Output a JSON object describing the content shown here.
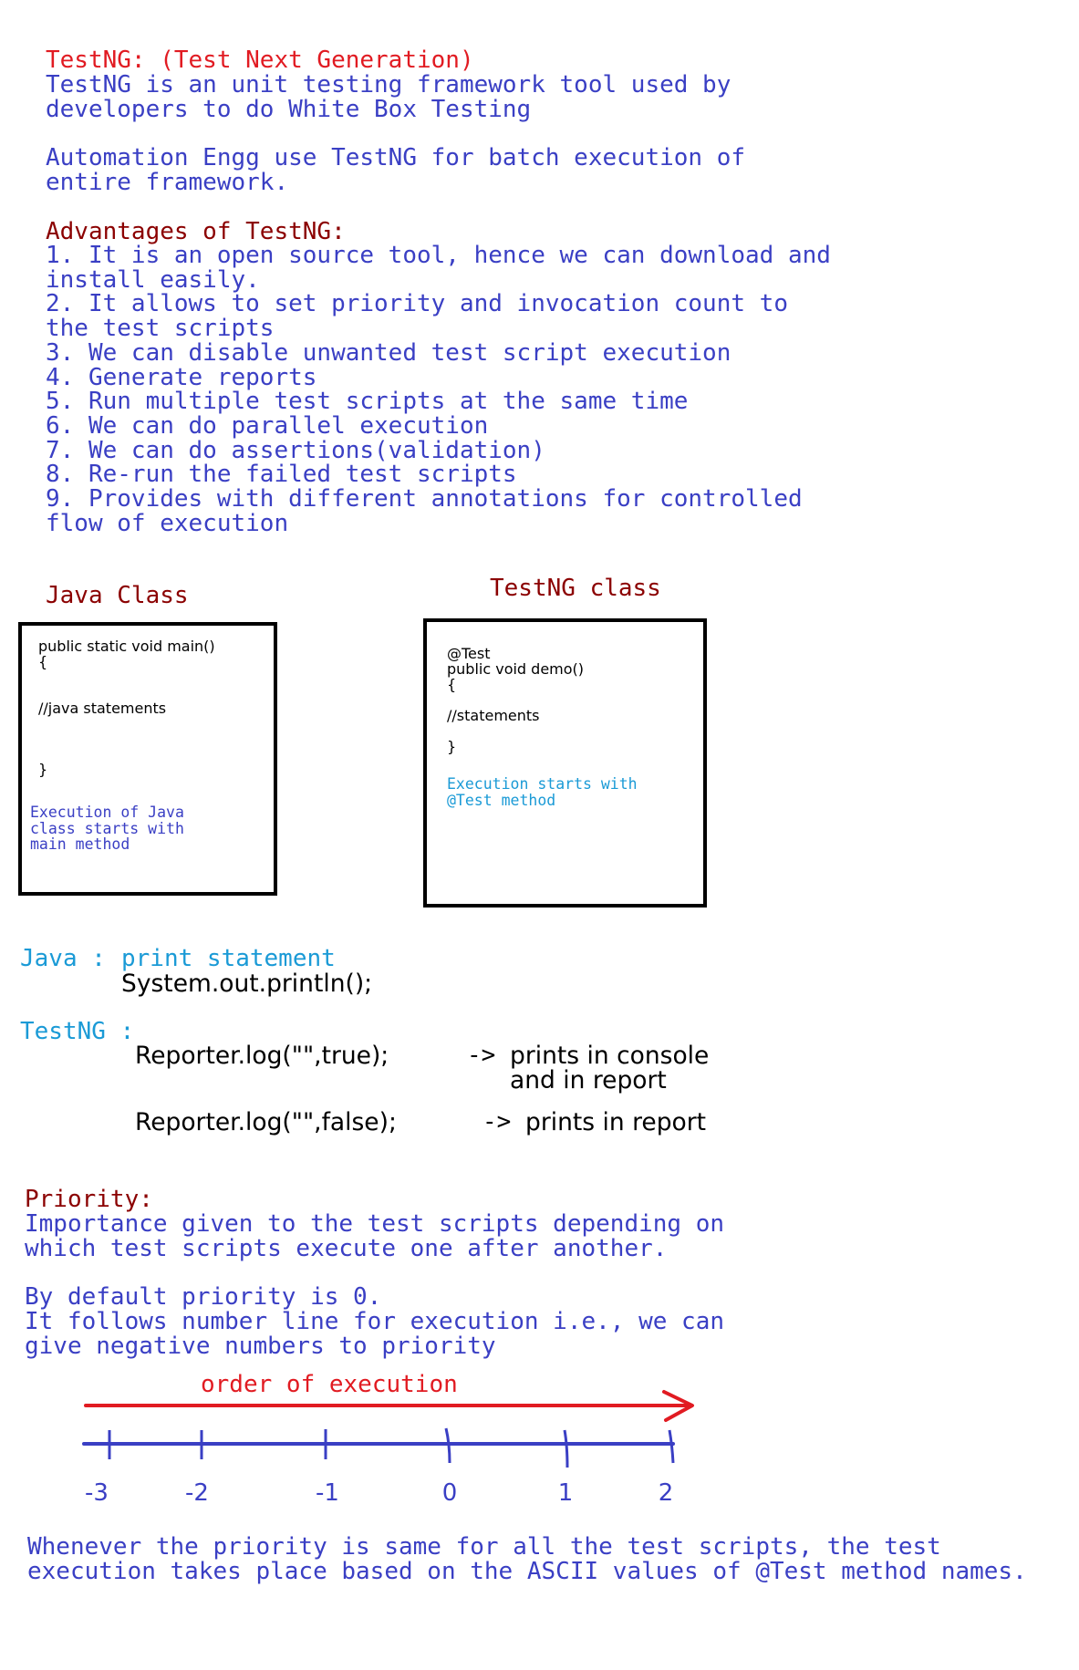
{
  "intro": {
    "title": "TestNG: (Test Next Generation)",
    "description": "TestNG is an unit testing framework tool used by\ndevelopers to do White Box Testing",
    "automation": "Automation Engg use TestNG for batch execution of\nentire framework."
  },
  "advantages": {
    "heading": "Advantages of TestNG:",
    "items": [
      "1. It is an open source tool, hence we can download and\ninstall easily.",
      "2. It allows to set priority and invocation count to\nthe test scripts",
      "3. We can disable unwanted test script execution",
      "4. Generate reports",
      "5. Run multiple test scripts at the same time",
      "6. We can do parallel execution",
      "7. We can do assertions(validation)",
      "8. Re-run the failed test scripts",
      "9. Provides with different annotations for controlled\nflow of execution"
    ]
  },
  "java_class": {
    "label": "Java Class",
    "code_signature": "public static void main()\n{",
    "code_body": "//java statements",
    "code_close": "}",
    "note": "Execution of Java\nclass starts with\nmain method"
  },
  "testng_class": {
    "label": "TestNG class",
    "code_signature": "@Test\npublic void demo()\n{",
    "code_body": "//statements",
    "code_close": "}",
    "note": "Execution starts with\n@Test method"
  },
  "print": {
    "java_label": "Java :",
    "java_desc": "print statement",
    "java_code": "System.out.println();",
    "testng_label": "TestNG :",
    "log_true": "Reporter.log(\"\",true);",
    "log_true_arrow": "->",
    "log_true_desc": "prints in console\nand in report",
    "log_false": "Reporter.log(\"\",false);",
    "log_false_arrow": "->",
    "log_false_desc": "prints in report"
  },
  "priority": {
    "heading": "Priority:",
    "definition": "Importance given to the test scripts depending on\nwhich test scripts execute one after another.",
    "default": "By default priority is 0.\nIt follows number line for execution i.e., we can\ngive negative numbers to priority",
    "order_label": "order of execution",
    "ticks": [
      "-3",
      "-2",
      "-1",
      "0",
      "1",
      "2"
    ],
    "footer": "Whenever the priority is same for all the test scripts, the test\nexecution takes place based on the ASCII values of @Test method names."
  },
  "colors": {
    "red": "#e11b22",
    "maroon": "#8b0000",
    "blue": "#3a3fc4",
    "cyan": "#1a9ad6",
    "black": "#000000"
  }
}
